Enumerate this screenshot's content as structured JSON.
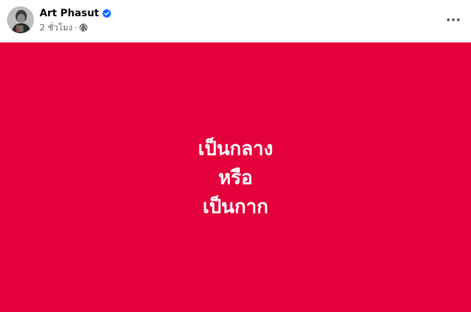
{
  "post": {
    "author": {
      "name": "Art Phasut",
      "verified": true,
      "avatar_icon": "user-avatar-photo"
    },
    "meta": {
      "timestamp": "2 ชั่วโมง",
      "separator": "·",
      "audience_icon": "globe-icon"
    },
    "more_icon": "more-options-icon",
    "body": {
      "background_color": "#e4003a",
      "text_color": "#ffffff",
      "lines": [
        "เป็นกลาง",
        "หรือ",
        "เป็นกาก"
      ]
    }
  },
  "colors": {
    "verified_badge": "#0866ff",
    "secondary_text": "#65676b",
    "primary_text": "#050505"
  }
}
